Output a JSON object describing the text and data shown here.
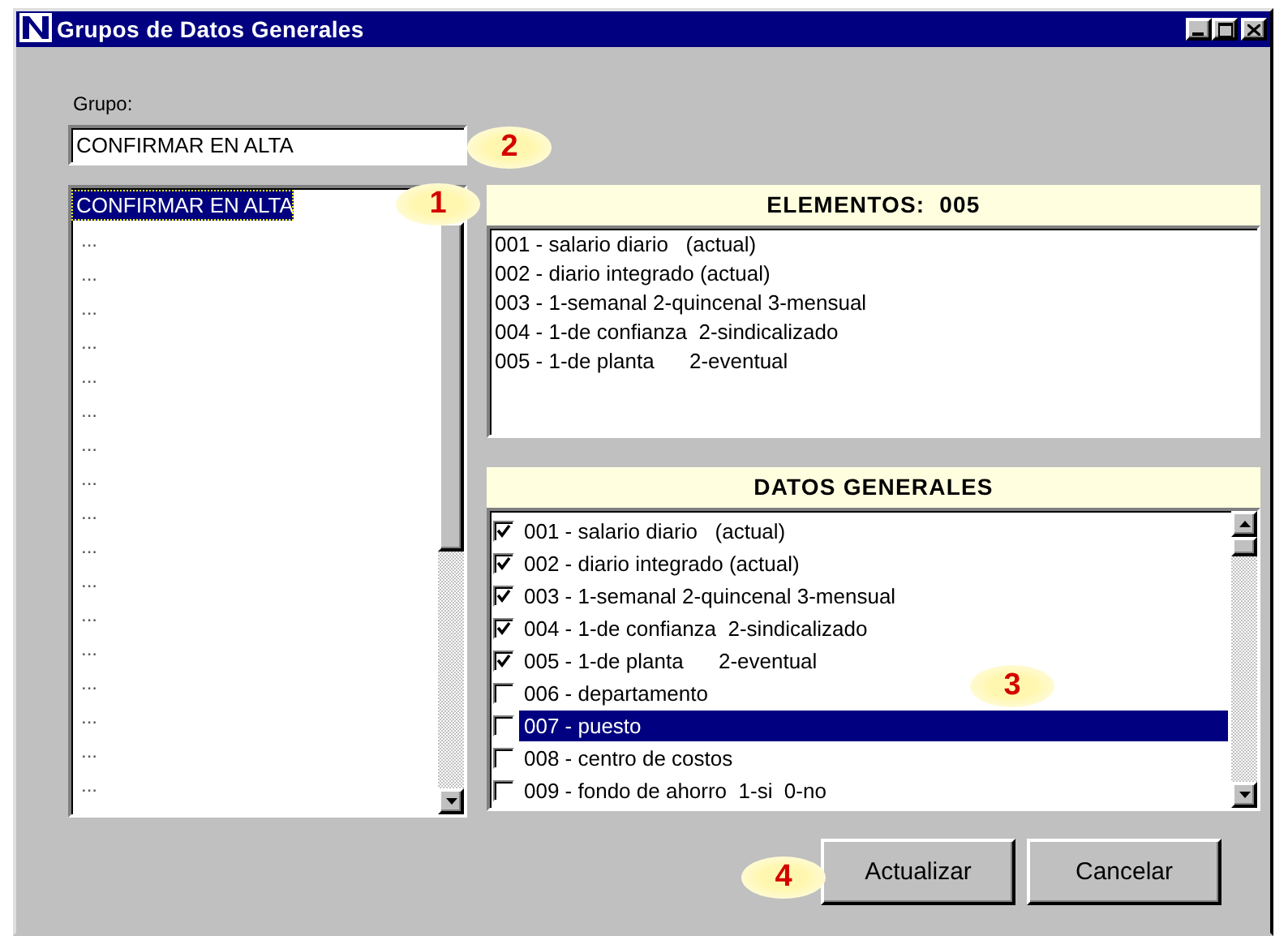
{
  "window": {
    "title": "Grupos de Datos Generales"
  },
  "grupo": {
    "label": "Grupo:",
    "value": "CONFIRMAR EN ALTA"
  },
  "grupos_list": [
    {
      "text": "CONFIRMAR EN ALTA",
      "selected": true
    },
    {
      "text": "...",
      "selected": false
    },
    {
      "text": "...",
      "selected": false
    },
    {
      "text": "...",
      "selected": false
    },
    {
      "text": "...",
      "selected": false
    },
    {
      "text": "...",
      "selected": false
    },
    {
      "text": "...",
      "selected": false
    },
    {
      "text": "...",
      "selected": false
    },
    {
      "text": "...",
      "selected": false
    },
    {
      "text": "...",
      "selected": false
    },
    {
      "text": "...",
      "selected": false
    },
    {
      "text": "...",
      "selected": false
    },
    {
      "text": "...",
      "selected": false
    },
    {
      "text": "...",
      "selected": false
    },
    {
      "text": "...",
      "selected": false
    },
    {
      "text": "...",
      "selected": false
    },
    {
      "text": "...",
      "selected": false
    },
    {
      "text": "...",
      "selected": false
    }
  ],
  "elementos": {
    "title": "ELEMENTOS:  005",
    "items": [
      "001 - salario diario   (actual)",
      "002 - diario integrado (actual)",
      "003 - 1-semanal 2-quincenal 3-mensual",
      "004 - 1-de confianza  2-sindicalizado",
      "005 - 1-de planta      2-eventual"
    ]
  },
  "datos_generales": {
    "title": "DATOS GENERALES",
    "items": [
      {
        "text": "001 - salario diario   (actual)",
        "checked": true,
        "selected": false
      },
      {
        "text": "002 - diario integrado (actual)",
        "checked": true,
        "selected": false
      },
      {
        "text": "003 - 1-semanal 2-quincenal 3-mensual",
        "checked": true,
        "selected": false
      },
      {
        "text": "004 - 1-de confianza  2-sindicalizado",
        "checked": true,
        "selected": false
      },
      {
        "text": "005 - 1-de planta      2-eventual",
        "checked": true,
        "selected": false
      },
      {
        "text": "006 - departamento",
        "checked": false,
        "selected": false
      },
      {
        "text": "007 - puesto",
        "checked": false,
        "selected": true
      },
      {
        "text": "008 - centro de costos",
        "checked": false,
        "selected": false
      },
      {
        "text": "009 - fondo de ahorro  1-si  0-no",
        "checked": false,
        "selected": false
      }
    ]
  },
  "buttons": [
    "Actualizar",
    "Cancelar"
  ],
  "callouts": [
    "1",
    "2",
    "3",
    "4"
  ]
}
